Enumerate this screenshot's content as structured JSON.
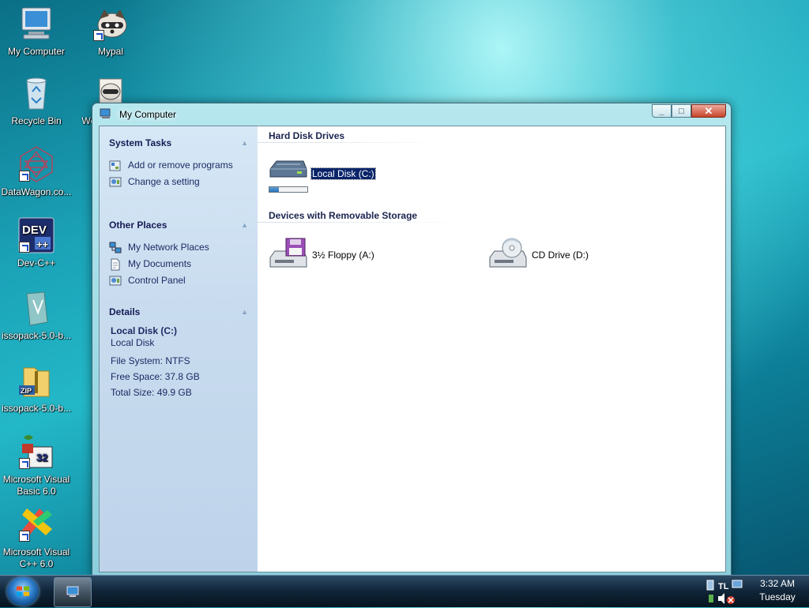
{
  "desktop": {
    "icons": [
      {
        "label": "My Computer",
        "icon": "my-computer-icon"
      },
      {
        "label": "Mypal",
        "icon": "mypal-icon"
      },
      {
        "label": "Recycle Bin",
        "icon": "recycle-bin-icon"
      },
      {
        "label": "Welcome to ... (partially hidden)",
        "label_short": "Welcome to...",
        "icon": "welcome-icon"
      },
      {
        "label": "DataWagon.co...",
        "icon": "datawagon-icon"
      },
      {
        "label": "Dev-C++",
        "icon": "dev-cpp-icon"
      },
      {
        "label": "issopack-5.0-b...",
        "icon": "installer-icon"
      },
      {
        "label": "issopack-5.0-b...",
        "icon": "zip-folder-icon"
      },
      {
        "label": "Microsoft Visual Basic 6.0",
        "icon": "visual-basic-icon"
      },
      {
        "label": "Microsoft Visual C++ 6.0",
        "icon": "visual-cpp-icon"
      }
    ]
  },
  "window": {
    "title": "My Computer",
    "controls": {
      "minimize": "_",
      "maximize": "□",
      "close": "✕"
    }
  },
  "taskpane": {
    "system_tasks": {
      "header": "System Tasks",
      "items": [
        "Add or remove programs",
        "Change a setting"
      ]
    },
    "other_places": {
      "header": "Other Places",
      "items": [
        "My Network Places",
        "My Documents",
        "Control Panel"
      ]
    },
    "details": {
      "header": "Details",
      "name": "Local Disk (C:)",
      "type": "Local Disk",
      "file_system": "File System: NTFS",
      "free_space": "Free Space: 37.8 GB",
      "total_size": "Total Size: 49.9 GB"
    }
  },
  "content": {
    "hard_disk_drives": {
      "header": "Hard Disk Drives",
      "drives": [
        {
          "label": "Local Disk (C:)",
          "used_fraction": 0.24
        }
      ]
    },
    "removable": {
      "header": "Devices with Removable Storage",
      "drives": [
        {
          "label": "3½ Floppy (A:)",
          "icon": "floppy-drive-icon"
        },
        {
          "label": "CD Drive (D:)",
          "icon": "cd-drive-icon"
        }
      ]
    }
  },
  "taskbar": {
    "clock_time": "3:32 AM",
    "clock_day": "Tuesday"
  }
}
